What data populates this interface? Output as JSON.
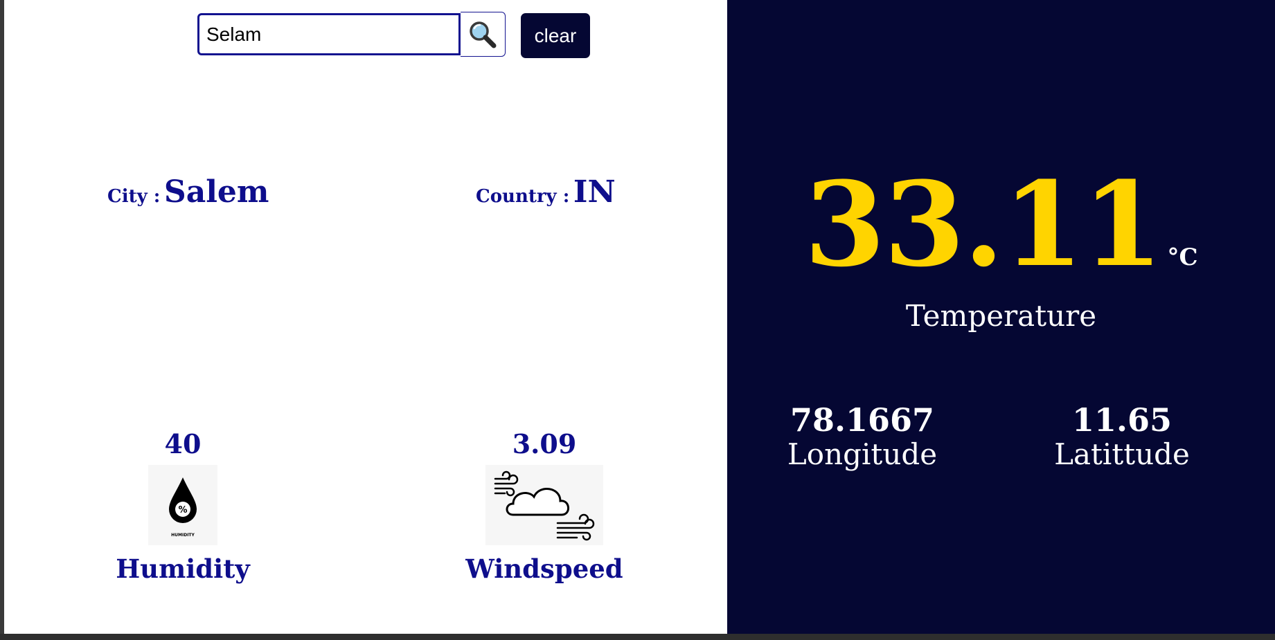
{
  "search": {
    "value": "Selam",
    "placeholder": ""
  },
  "buttons": {
    "clear": "clear"
  },
  "location": {
    "city_label": "City :",
    "city_value": "Salem",
    "country_label": "Country :",
    "country_value": "IN"
  },
  "metrics": {
    "humidity": {
      "value": "40",
      "label": "Humidity",
      "icon_caption": "HUMIDITY"
    },
    "windspeed": {
      "value": "3.09",
      "label": "Windspeed"
    }
  },
  "temperature": {
    "value": "33.11",
    "unit": "°C",
    "label": "Temperature"
  },
  "coordinates": {
    "longitude": {
      "value": "78.1667",
      "label": "Longitude"
    },
    "latitude": {
      "value": "11.65",
      "label": "Latittude"
    }
  },
  "colors": {
    "navy": "#0e0e8c",
    "panel": "#050733",
    "temp": "#ffd400"
  },
  "icons": [
    "search-icon",
    "humidity-drop-icon",
    "wind-cloud-icon"
  ]
}
